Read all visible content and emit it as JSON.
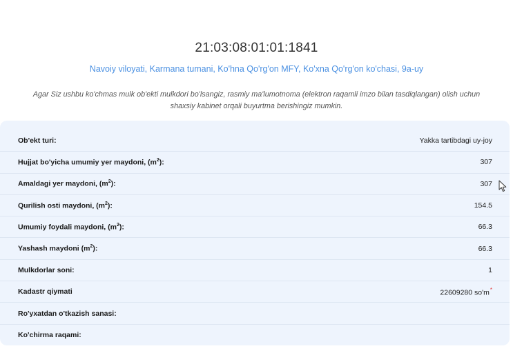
{
  "header": {
    "cadastre_number": "21:03:08:01:01:1841",
    "address": "Navoiy viloyati, Karmana tumani, Ko'hna Qo'rg'on MFY, Ko'xna Qo'rg'on ko'chasi, 9a-uy",
    "notice": "Agar Siz ushbu ko'chmas mulk ob'ekti mulkdori bo'lsangiz, rasmiy ma'lumotnoma (elektron raqamli imzo bilan tasdiqlangan) olish uchun shaxsiy kabinet orqali buyurtma berishingiz mumkin."
  },
  "details": {
    "object_type": {
      "label": "Ob'ekt turi:",
      "value": "Yakka tartibdagi uy-joy"
    },
    "total_land_area": {
      "label": "Hujjat bo'yicha umumiy yer maydoni, (m",
      "label_sup": "2",
      "label_end": "):",
      "value": "307"
    },
    "actual_land_area": {
      "label": "Amaldagi yer maydoni, (m",
      "label_sup": "2",
      "label_end": "):",
      "value": "307"
    },
    "built_area": {
      "label": "Qurilish osti maydoni, (m",
      "label_sup": "2",
      "label_end": "):",
      "value": "154.5"
    },
    "total_useful_area": {
      "label": "Umumiy foydali maydoni, (m",
      "label_sup": "2",
      "label_end": "):",
      "value": "66.3"
    },
    "living_area": {
      "label": "Yashash maydoni (m",
      "label_sup": "2",
      "label_end": "):",
      "value": "66.3"
    },
    "owners_count": {
      "label": "Mulkdorlar soni:",
      "value": "1"
    },
    "cadastral_value": {
      "label": "Kadastr qiymati",
      "value": "22609280 so'm",
      "mark": "*"
    },
    "registration_date": {
      "label": "Ro'yxatdan o'tkazish sanasi:",
      "value": ""
    },
    "extract_number": {
      "label": "Ko'chirma raqami:",
      "value": ""
    }
  }
}
